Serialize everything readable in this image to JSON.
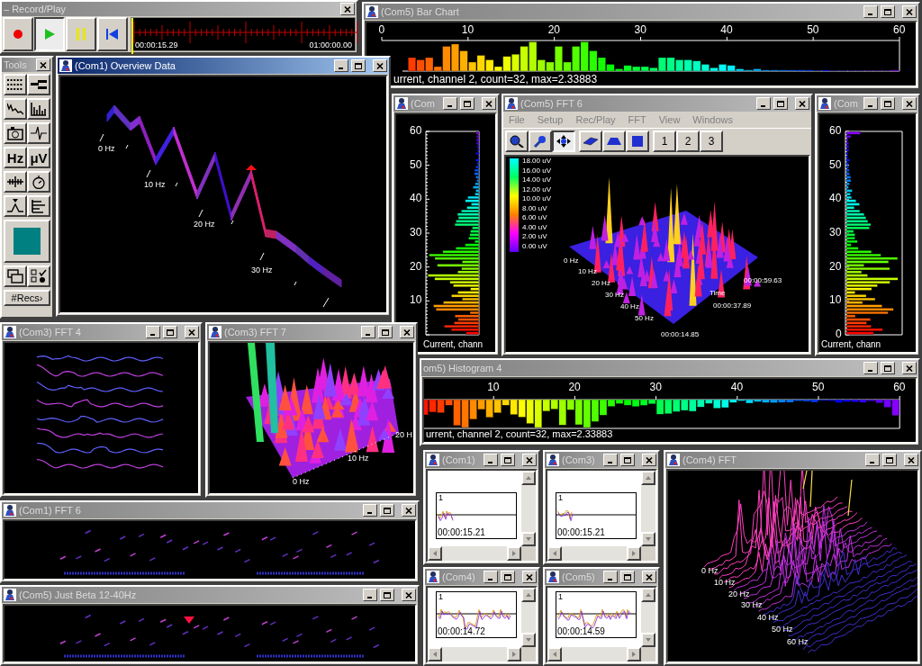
{
  "record_play": {
    "title": "– Record/Play",
    "buttons": [
      {
        "kind": "record",
        "selected": false
      },
      {
        "kind": "play",
        "selected": true
      },
      {
        "kind": "pause",
        "selected": false
      },
      {
        "kind": "rewind",
        "selected": false
      }
    ],
    "position": "00:00:15.29",
    "duration": "01:00:00.00"
  },
  "tools": {
    "title": "Tools",
    "units": [
      "Hz",
      "μV"
    ],
    "records_button": "#Recs›"
  },
  "windows": [
    {
      "kind": "bar_chart",
      "title": "(Com5) Bar Chart",
      "active": false,
      "clipped": false,
      "ticks": [
        "0",
        "10",
        "20",
        "30",
        "40",
        "50",
        "60"
      ],
      "caption": "urrent, channel 2, count=32, max=2.33883"
    },
    {
      "kind": "overview",
      "title": "(Com1) Overview Data",
      "active": true,
      "clipped": false,
      "labels": [
        "0 Hz",
        "10 Hz",
        "20 Hz",
        "30 Hz"
      ]
    },
    {
      "kind": "vhist",
      "title": "(Com",
      "active": false,
      "clipped": false,
      "ticks": [
        "60",
        "50",
        "40",
        "30",
        "20",
        "10"
      ],
      "caption": "Current, chann"
    },
    {
      "kind": "fft_view",
      "title": "(Com5) FFT 6",
      "active": false,
      "clipped": false,
      "menu": [
        "File",
        "Setup",
        "Rec/Play",
        "FFT",
        "View",
        "Windows"
      ],
      "view_tools": [
        {
          "selected": false
        },
        {
          "selected": false
        },
        {
          "selected": true
        },
        {
          "selected": false
        },
        {
          "selected": false
        },
        {
          "selected": false
        }
      ],
      "pages": [
        {
          "label": "1",
          "selected": false
        },
        {
          "label": "2",
          "selected": false
        },
        {
          "label": "3",
          "selected": false
        }
      ],
      "amplitude_labels": [
        "18.00 uV",
        "16.00 uV",
        "14.00 uV",
        "12.00 uV",
        "10.00 uV",
        "8.00 uV",
        "6.00 uV",
        "4.00 uV",
        "2.00 uV",
        "0.00 uV"
      ],
      "frequency_labels": [
        "0 Hz",
        "10 Hz",
        "20 Hz",
        "30 Hz",
        "40 Hz",
        "50 Hz"
      ],
      "time_labels": [
        "00:00:59.63",
        "00:00:37.89",
        "00:00:14.85"
      ],
      "time_axis": "Time"
    },
    {
      "kind": "vhist",
      "title": "(Com",
      "active": false,
      "clipped": false,
      "ticks": [
        "60",
        "50",
        "40",
        "30",
        "20",
        "10",
        "0"
      ],
      "caption": "Current, chann"
    },
    {
      "kind": "hist_down",
      "title": "om5) Histogram 4",
      "active": false,
      "clipped": true,
      "ticks": [
        "10",
        "20",
        "30",
        "40",
        "50",
        "60"
      ],
      "caption": "urrent, channel 2, count=32, max=2.33883"
    },
    {
      "kind": "waterfall",
      "title": "(Com3) FFT 4",
      "active": false,
      "clipped": false
    },
    {
      "kind": "surface",
      "title": "(Com3) FFT 7",
      "active": false,
      "clipped": false,
      "labels": [
        "0 Hz",
        "10 Hz",
        "20 H"
      ]
    },
    {
      "kind": "strip",
      "title": "(Com1) FFT 6",
      "active": false,
      "clipped": false,
      "marker": false
    },
    {
      "kind": "strip",
      "title": "(Com5) Just Beta 12-40Hz",
      "active": false,
      "clipped": false,
      "marker": true
    },
    {
      "kind": "mini",
      "title": "(Com1)",
      "active": false,
      "clipped": false,
      "scale": "1",
      "time": "00:00:15.21"
    },
    {
      "kind": "mini",
      "title": "(Com3)",
      "active": false,
      "clipped": false,
      "scale": "1",
      "time": "00:00:15.21"
    },
    {
      "kind": "mini",
      "title": "(Com4)",
      "active": false,
      "clipped": false,
      "scale": "1",
      "time": "00:00:14.72"
    },
    {
      "kind": "mini",
      "title": "(Com5)",
      "active": false,
      "clipped": false,
      "scale": "1",
      "time": "00:00:14.59"
    },
    {
      "kind": "fft_lines",
      "title": "(Com4) FFT",
      "active": false,
      "clipped": false,
      "labels": [
        "0 Hz",
        "10 Hz",
        "20 Hz",
        "30 Hz",
        "40 Hz",
        "50 Hz",
        "60 Hz"
      ]
    }
  ]
}
